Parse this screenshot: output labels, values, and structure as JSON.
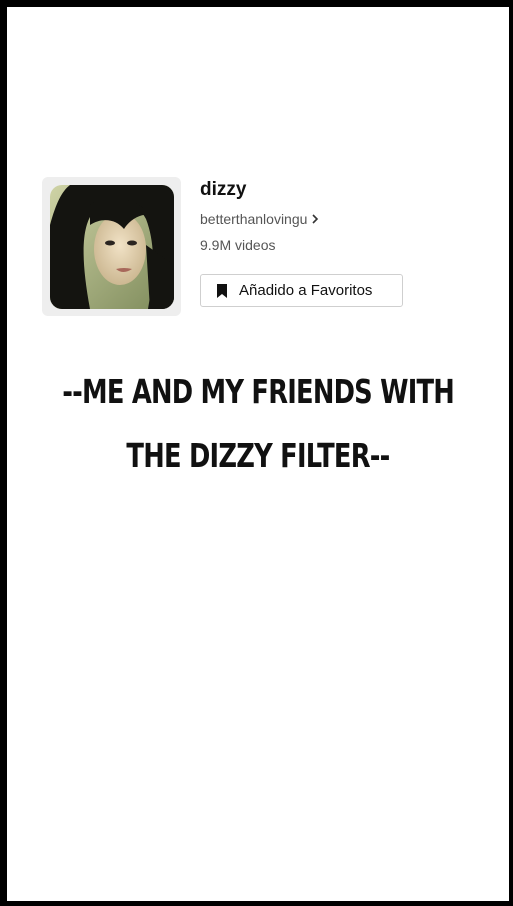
{
  "effect": {
    "name": "dizzy",
    "creator": "betterthanlovingu",
    "video_count": "9.9M videos",
    "thumbnail_icon": "effect-thumbnail"
  },
  "favorite_button": {
    "label": "Añadido a Favoritos",
    "icon": "bookmark-icon"
  },
  "caption": {
    "line1": "--ME AND MY FRIENDS WITH",
    "line2": "THE DIZZY FILTER--"
  },
  "colors": {
    "background": "#ffffff",
    "frame": "#000000",
    "text_primary": "#111111",
    "text_secondary": "#555555",
    "button_border": "#cfcfcf"
  }
}
